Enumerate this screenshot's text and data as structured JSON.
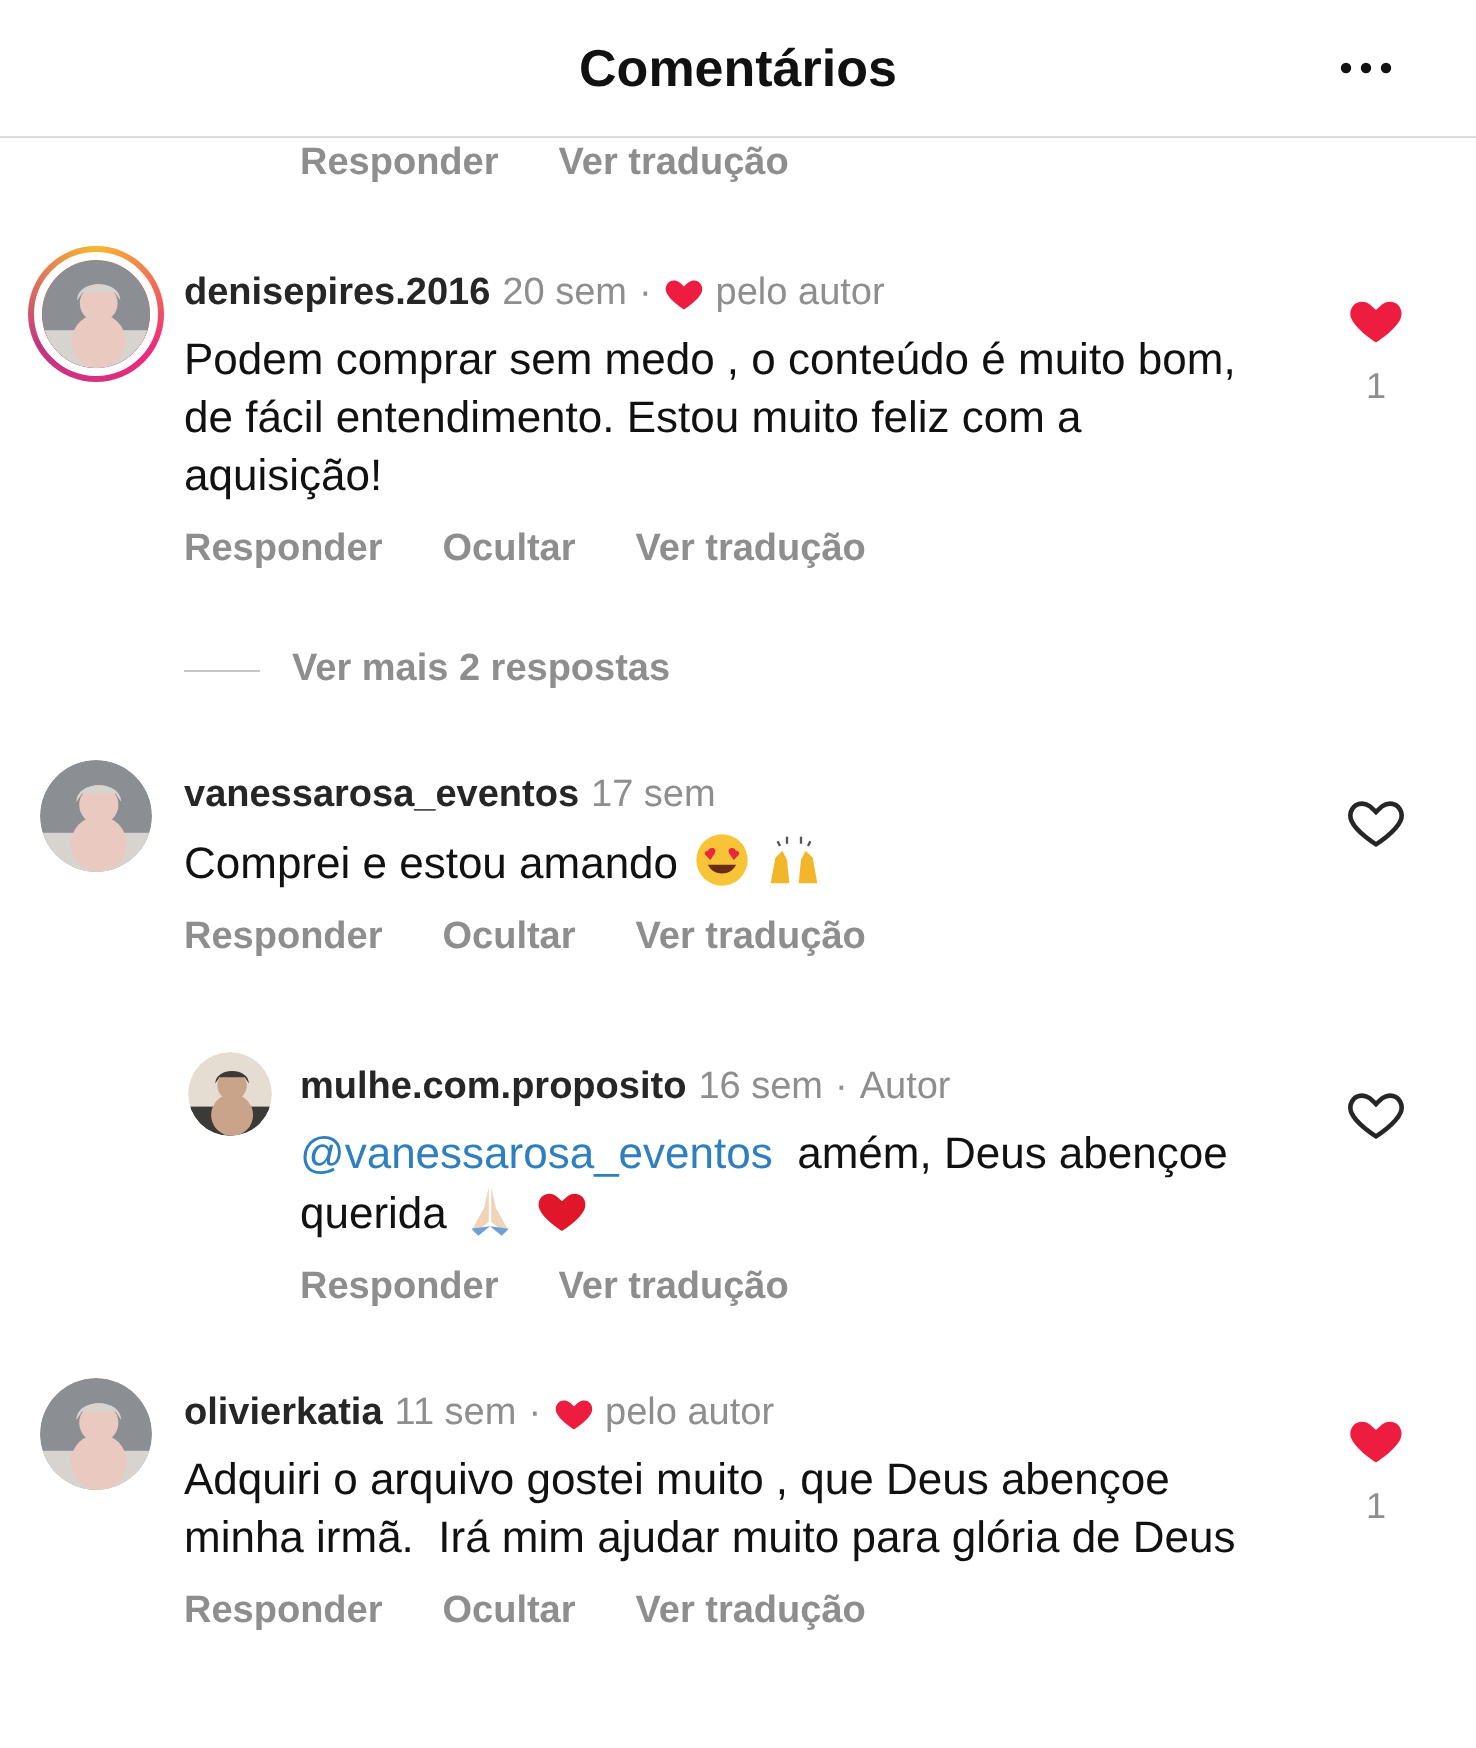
{
  "header": {
    "title": "Comentários"
  },
  "top_actions": [
    "Responder",
    "Ver tradução"
  ],
  "comments": [
    {
      "username": "denisepires.2016",
      "time": "20 sem",
      "separator": "·",
      "liked_by_author": true,
      "author_like_label": "pelo autor",
      "story": true,
      "text": "Podem comprar sem medo , o conteúdo é muito bom, de fácil entendimento. Estou muito feliz com a aquisição!",
      "liked": true,
      "likes": "1",
      "actions": [
        "Responder",
        "Ocultar",
        "Ver tradução"
      ],
      "more_replies": "Ver mais 2 respostas"
    },
    {
      "username": "vanessarosa_eventos",
      "time": "17 sem",
      "liked_by_author": false,
      "story": false,
      "text": "Comprei e estou amando",
      "emoji": [
        {
          "kind": "heart-eyes"
        },
        {
          "kind": "raised-hands"
        }
      ],
      "liked": false,
      "actions": [
        "Responder",
        "Ocultar",
        "Ver tradução"
      ],
      "replies": [
        {
          "username": "mulhe.com.proposito",
          "time": "16 sem",
          "separator": "·",
          "badge": "Autor",
          "story": false,
          "mention": "@vanessarosa_eventos",
          "text": "amém, Deus abençoe querida",
          "emoji": [
            {
              "kind": "praying-hands"
            },
            {
              "kind": "red-heart"
            }
          ],
          "liked": false,
          "actions": [
            "Responder",
            "Ver tradução"
          ]
        }
      ]
    },
    {
      "username": "olivierkatia",
      "time": "11 sem",
      "separator": "·",
      "liked_by_author": true,
      "author_like_label": "pelo autor",
      "story": false,
      "text": "Adquiri o arquivo gostei muito , que Deus abençoe minha irmã.  Irá mim ajudar muito para glória de Deus",
      "liked": true,
      "likes": "1",
      "actions": [
        "Responder",
        "Ocultar",
        "Ver tradução"
      ]
    }
  ]
}
